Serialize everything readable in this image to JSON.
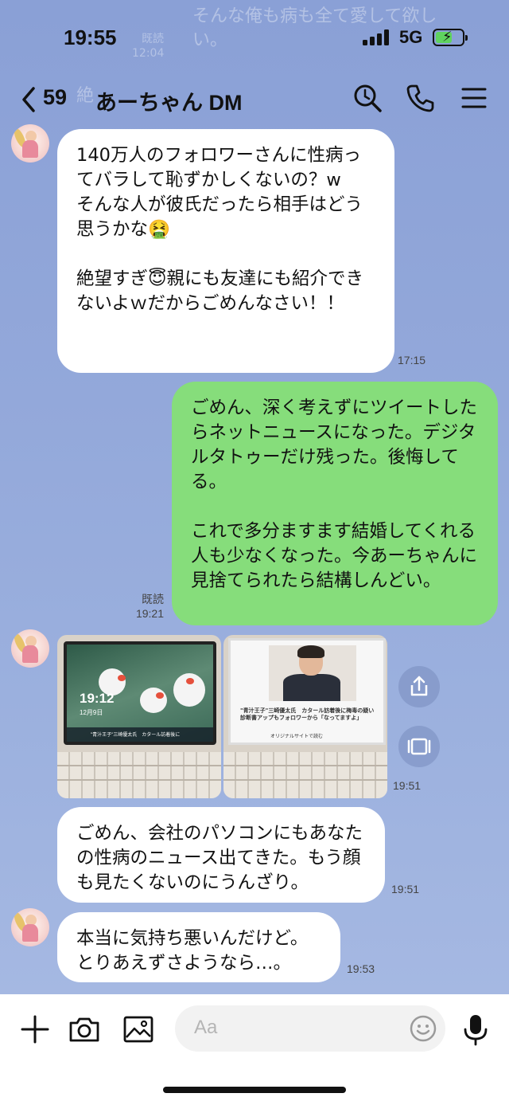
{
  "status_bar": {
    "time": "19:55",
    "network": "5G"
  },
  "background_ghost": {
    "line1": "そんな俺も病も全て愛して欲し",
    "line2": "い。",
    "ghost_time_top": "12:04",
    "ghost_read": "既読",
    "ghost_left": "絶"
  },
  "header": {
    "back_count": "59",
    "title": "あーちゃん DM",
    "icons": [
      "back-chevron-icon",
      "search-icon",
      "phone-icon",
      "menu-icon"
    ]
  },
  "messages": [
    {
      "side": "in",
      "text": "140万人のフォロワーさんに性病ってバラして恥ずかしくないの？w\nそんな人が彼氏だったら相手はどう思うかな🤮\n\n絶望すぎ😇親にも友達にも紹介できないよｗだからごめんなさい！！",
      "time": "17:15"
    },
    {
      "side": "out",
      "text": "ごめん、深く考えずにツイートしたらネットニュースになった。デジタルタトゥーだけ残った。後悔してる。\n\nこれで多分ますます結婚してくれる人も少なくなった。今あーちゃんに見捨てられたら結構しんどい。",
      "read": "既読",
      "time": "19:21"
    },
    {
      "side": "in",
      "type": "photos",
      "photo1_clock": "19:12",
      "photo1_date": "12月9日",
      "photo1_caption": "\"青汁王子\"三崎優太氏　カタール訪着後に",
      "photo2_headline": "\"青汁王子\"三崎優太氏　カタール訪着後に梅毒の疑い　診断書アップもフォロワーから「なってますよ」",
      "photo2_link": "オリジナルサイトで読む",
      "time": "19:51"
    },
    {
      "side": "in",
      "text": "ごめん、会社のパソコンにもあなたの性病のニュース出てきた。もう顔も見たくないのにうんざり。",
      "time": "19:51"
    },
    {
      "side": "in",
      "text": "本当に気持ち悪いんだけど。\nとりあえずさようなら…。",
      "time": "19:53"
    }
  ],
  "side_buttons": [
    "share-icon",
    "expand-icon"
  ],
  "input_bar": {
    "placeholder": "Aa",
    "icons": [
      "plus-icon",
      "camera-icon",
      "image-icon",
      "emoji-icon",
      "microphone-icon"
    ]
  },
  "colors": {
    "background": "#8fa4d8",
    "incoming_bubble": "#ffffff",
    "outgoing_bubble": "#86dd7b"
  }
}
